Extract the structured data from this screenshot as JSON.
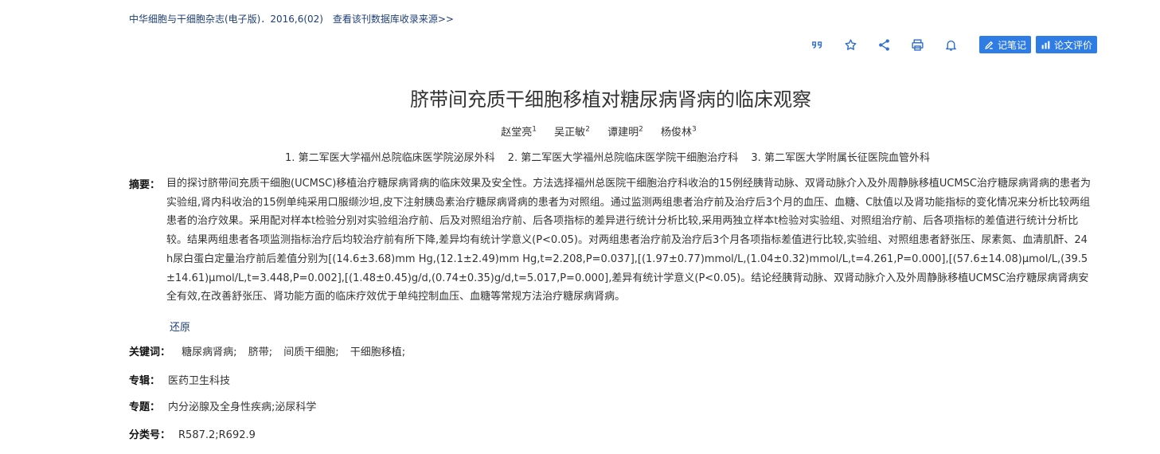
{
  "header": {
    "journal": "中华细胞与干细胞杂志(电子版)．2016,6(02)",
    "source_link": "查看该刊数据库收录来源>>"
  },
  "toolbar": {
    "icons": [
      "quote-icon",
      "star-icon",
      "share-icon",
      "print-icon",
      "bell-icon"
    ],
    "note_button": "记笔记",
    "review_button": "论文评价",
    "accent_color": "#2f7ce4"
  },
  "article": {
    "title": "脐带间充质干细胞移植对糖尿病肾病的临床观察",
    "authors": [
      {
        "name": "赵堂亮",
        "sup": "1"
      },
      {
        "name": "吴正敏",
        "sup": "2"
      },
      {
        "name": "谭建明",
        "sup": "2"
      },
      {
        "name": "杨俊林",
        "sup": "3"
      }
    ],
    "orgs": [
      "1. 第二军医大学福州总院临床医学院泌尿外科",
      "2. 第二军医大学福州总院临床医学院干细胞治疗科",
      "3. 第二军医大学附属长征医院血管外科"
    ],
    "abstract_label": "摘要：",
    "abstract": "目的探讨脐带间充质干细胞(UCMSC)移植治疗糖尿病肾病的临床效果及安全性。方法选择福州总医院干细胞治疗科收治的15例经胰背动脉、双肾动脉介入及外周静脉移植UCMSC治疗糖尿病肾病的患者为实验组,肾内科收治的15例单纯采用口服缬沙坦,皮下注射胰岛素治疗糖尿病肾病的患者为对照组。通过监测两组患者治疗前及治疗后3个月的血压、血糖、C肽值以及肾功能指标的变化情况来分析比较两组患者的治疗效果。采用配对样本t检验分别对实验组治疗前、后及对照组治疗前、后各项指标的差异进行统计分析比较,采用两独立样本t检验对实验组、对照组治疗前、后各项指标的差值进行统计分析比较。结果两组患者各项监测指标治疗后均较治疗前有所下降,差异均有统计学意义(P<0.05)。对两组患者治疗前及治疗后3个月各项指标差值进行比较,实验组、对照组患者舒张压、尿素氮、血清肌酐、24 h尿白蛋白定量治疗前后差值分别为[(14.6±3.68)mm Hg,(12.1±2.49)mm Hg,t=2.208,P=0.037],[(1.97±0.77)mmol/L,(1.04±0.32)mmol/L,t=4.261,P=0.000],[(57.6±14.08)μmol/L,(39.5±14.61)μmol/L,t=3.448,P=0.002],[(1.48±0.45)g/d,(0.74±0.35)g/d,t=5.017,P=0.000],差异有统计学意义(P<0.05)。结论经胰背动脉、双肾动脉介入及外周静脉移植UCMSC治疗糖尿病肾病安全有效,在改善舒张压、肾功能方面的临床疗效优于单纯控制血压、血糖等常规方法治疗糖尿病肾病。",
    "restore": "还原",
    "keywords_label": "关键词：",
    "keywords": [
      "糖尿病肾病;",
      "脐带;",
      "间质干细胞;",
      "干细胞移植;"
    ],
    "series_label": "专辑：",
    "series": "医药卫生科技",
    "topic_label": "专题：",
    "topic": "内分泌腺及全身性疾病;泌尿科学",
    "class_label": "分类号：",
    "class_no": "R587.2;R692.9"
  }
}
